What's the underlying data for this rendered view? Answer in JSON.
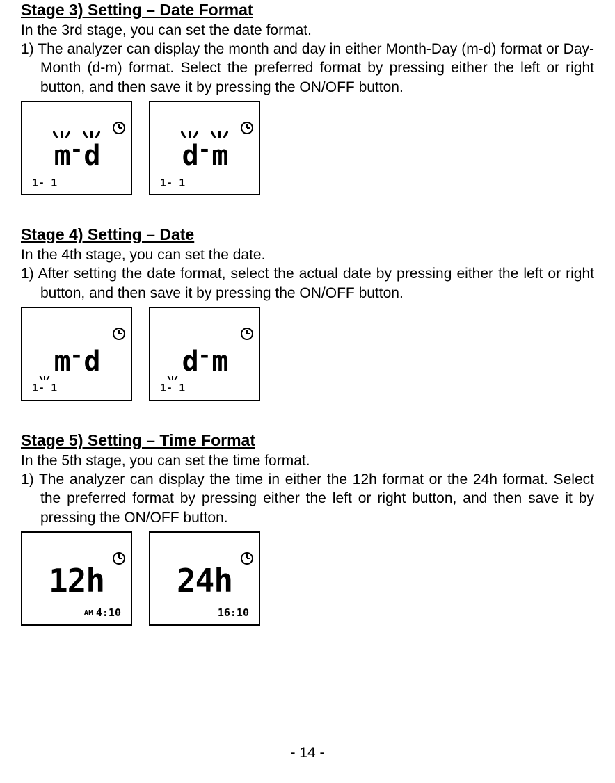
{
  "stage3": {
    "heading": "Stage 3) Setting – Date Format",
    "intro": "In the 3rd stage, you can set the date format.",
    "item1": "1) The analyzer can display the month and day in either Month-Day (m-d) format or Day-Month (d-m) format. Select the preferred format by pressing either the left or right button, and then save it by pressing the ON/OFF button.",
    "lcd": {
      "left_main_1": "m",
      "left_main_2": "d",
      "right_main_1": "d",
      "right_main_2": "m",
      "sub": "1- 1"
    }
  },
  "stage4": {
    "heading": "Stage 4) Setting – Date",
    "intro": "In the 4th stage, you can set the date.",
    "item1": "1) After setting the date format, select the actual date by pressing either the left or right button, and then save it by pressing the ON/OFF button.",
    "lcd": {
      "left_main_1": "m",
      "left_main_2": "d",
      "right_main_1": "d",
      "right_main_2": "m",
      "sub": "1- 1"
    }
  },
  "stage5": {
    "heading": "Stage 5) Setting – Time Format",
    "intro": "In the 5th stage, you can set the time format.",
    "item1": "1) The analyzer can display the time in either the 12h format or the 24h format. Select the preferred format by pressing either the left or right button, and then save it by pressing the ON/OFF button.",
    "lcd": {
      "left_main": "12h",
      "right_main": "24h",
      "left_sub_ampm": "AM",
      "left_sub": "4:10",
      "right_sub": "16:10"
    }
  },
  "page_number": "- 14 -"
}
